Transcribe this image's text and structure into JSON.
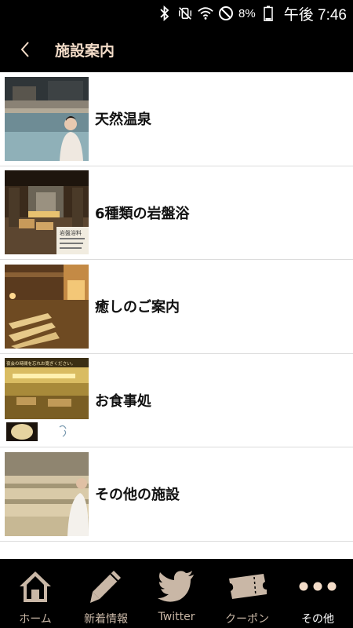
{
  "status_bar": {
    "battery_percent": "8%",
    "time": "午後 7:46"
  },
  "header": {
    "title": "施設案内"
  },
  "facilities": [
    {
      "label": "天然温泉"
    },
    {
      "label": "6種類の岩盤浴"
    },
    {
      "label": "癒しのご案内"
    },
    {
      "label": "お食事処"
    },
    {
      "label": "その他の施設"
    }
  ],
  "thumbnail_text": {
    "ganbanyoku_sign": "岩盤浴料",
    "restaurant_banner": "夜会の時間を忘れお寛ぎください。"
  },
  "bottom_nav": {
    "active_index": 4,
    "tabs": [
      {
        "label": "ホーム",
        "icon": "home-icon"
      },
      {
        "label": "新着情報",
        "icon": "pencil-icon"
      },
      {
        "label": "Twitter",
        "icon": "twitter-bird-icon"
      },
      {
        "label": "クーポン",
        "icon": "ticket-icon"
      },
      {
        "label": "その他",
        "icon": "more-dots-icon"
      }
    ]
  },
  "colors": {
    "header_bg": "#000000",
    "header_text": "#f3dcc8",
    "nav_icon": "#c9b7a6",
    "nav_active": "#ffffff"
  }
}
